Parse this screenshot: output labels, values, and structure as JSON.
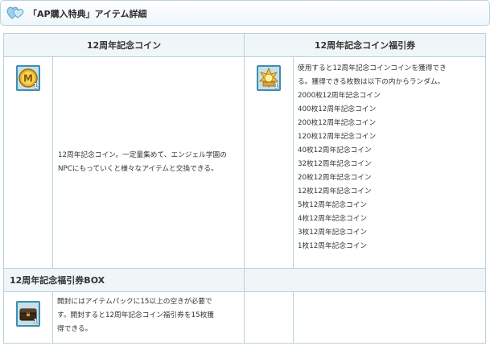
{
  "header": {
    "title": "「AP購入特典」アイテム詳細",
    "icon": "hearts-icon"
  },
  "table": {
    "col1_header": "12周年記念コイン",
    "col2_header": "12周年記念コイン福引券",
    "coin": {
      "icon": "gold-coin-icon",
      "count": "1",
      "description": "12周年記念コイン。一定量集めて、エンジェル学園のNPCにもっていくと様々なアイテムと交換できる。"
    },
    "ticket": {
      "icon": "golden-ticket-icon",
      "count": "1",
      "lines": [
        "使用すると12周年記念コインコインを獲得でき",
        "る。獲得できる枚数は以下の内からランダム。",
        "2000枚12周年記念コイン",
        "400枚12周年記念コイン",
        "200枚12周年記念コイン",
        "120枚12周年記念コイン",
        "40枚12周年記念コイン",
        "32枚12周年記念コイン",
        "20枚12周年記念コイン",
        "12枚12周年記念コイン",
        "5枚12周年記念コイン",
        "4枚12周年記念コイン",
        "3枚12周年記念コイン",
        "1枚12周年記念コイン"
      ]
    },
    "box_header": "12周年記念福引券BOX",
    "box": {
      "icon": "treasure-chest-icon",
      "count": "1",
      "lines": [
        "開封にはアイテムパックに15以上の空きが必要で",
        "す。開封すると12周年記念コイン福引券を15枚獲",
        "得できる。"
      ]
    }
  }
}
